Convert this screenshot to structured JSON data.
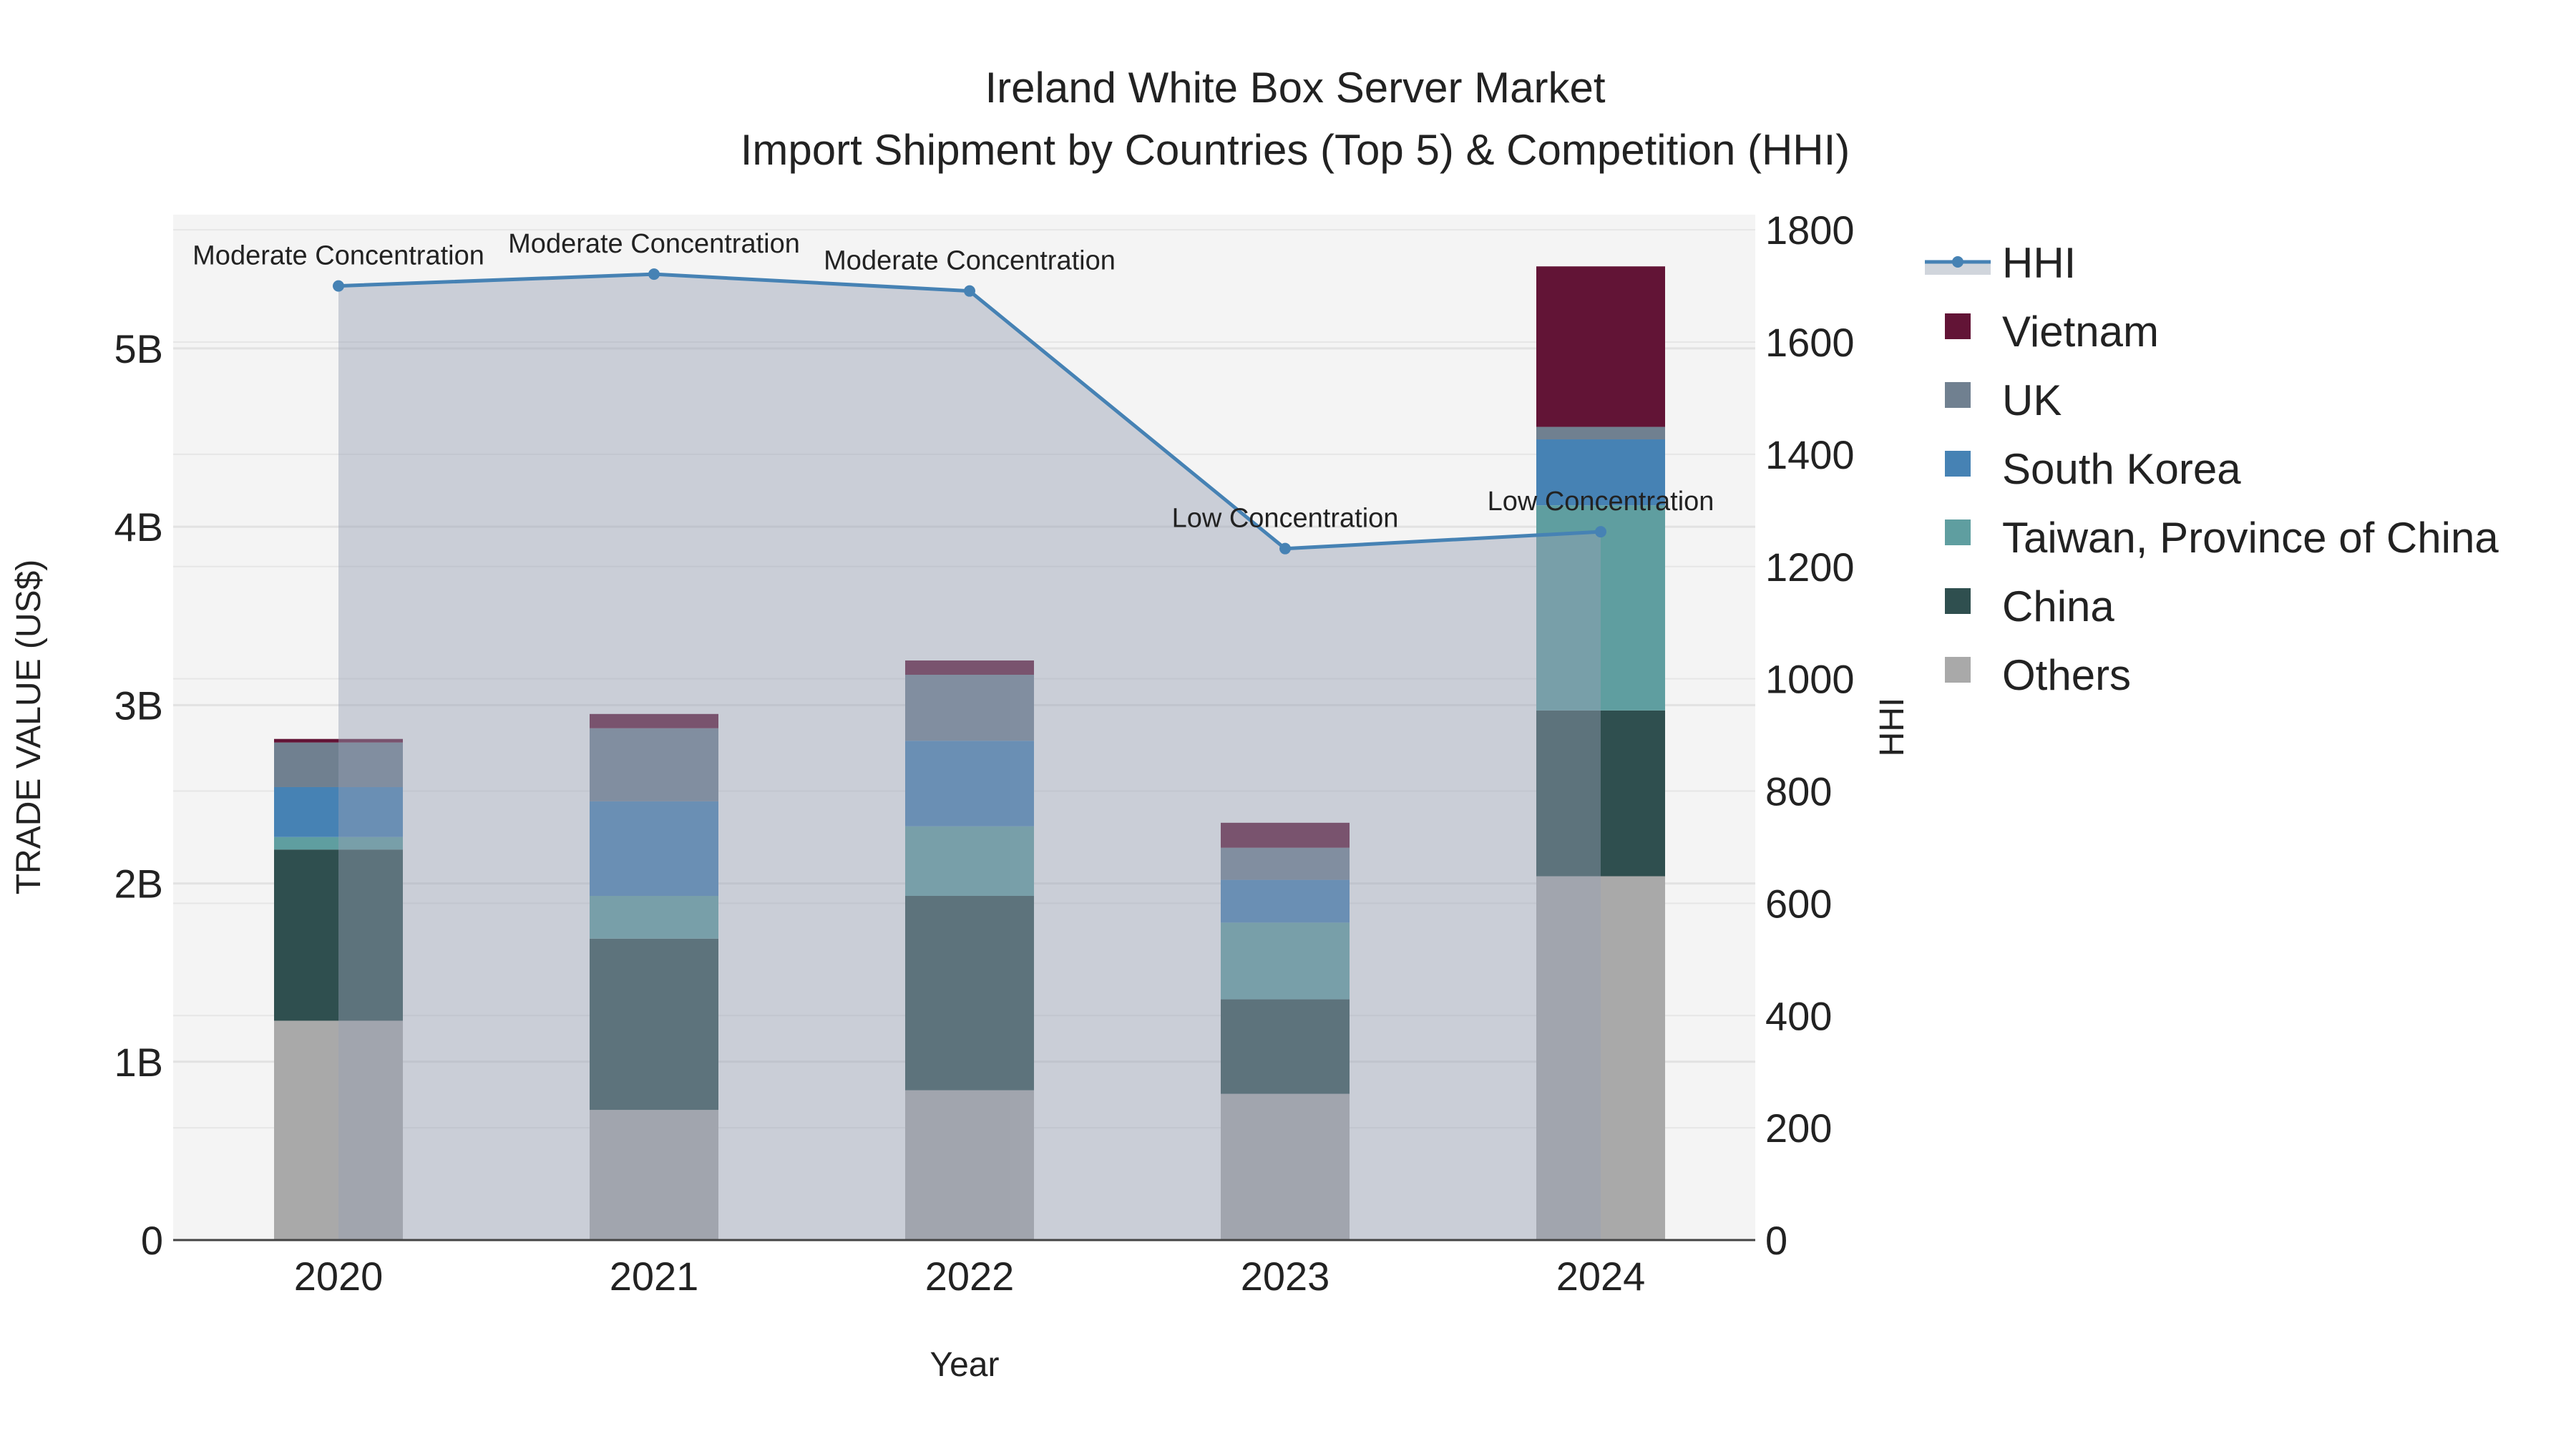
{
  "chart_data": {
    "type": "bar",
    "title": "Ireland White Box Server Market",
    "subtitle": "Import Shipment by Countries (Top 5) & Competition (HHI)",
    "xlabel": "Year",
    "ylabel": "TRADE VALUE (US$)",
    "y2label": "HHI",
    "categories": [
      "2020",
      "2021",
      "2022",
      "2023",
      "2024"
    ],
    "ylim": [
      0,
      5.75
    ],
    "y_ticks": [
      0,
      1,
      2,
      3,
      4,
      5
    ],
    "y_tick_labels": [
      "0",
      "1B",
      "2B",
      "3B",
      "4B",
      "5B"
    ],
    "y2lim": [
      0,
      1827
    ],
    "y2_ticks": [
      0,
      200,
      400,
      600,
      800,
      1000,
      1200,
      1400,
      1600,
      1800
    ],
    "y2_tick_labels": [
      "0",
      "200",
      "400",
      "600",
      "800",
      "1000",
      "1200",
      "1400",
      "1600",
      "1800"
    ],
    "units": "billion US$",
    "stacked": true,
    "legend_position": "right",
    "series": [
      {
        "name": "Others",
        "color": "#a9a9a9",
        "values": [
          1.23,
          0.73,
          0.84,
          0.82,
          2.04
        ]
      },
      {
        "name": "China",
        "color": "#2f4f4f",
        "values": [
          0.96,
          0.96,
          1.09,
          0.53,
          0.93
        ]
      },
      {
        "name": "Taiwan, Province of China",
        "color": "#5f9ea0",
        "values": [
          0.07,
          0.24,
          0.39,
          0.43,
          1.15
        ]
      },
      {
        "name": "South Korea",
        "color": "#4682b4",
        "values": [
          0.28,
          0.53,
          0.48,
          0.24,
          0.37
        ]
      },
      {
        "name": "UK",
        "color": "#708090",
        "values": [
          0.25,
          0.41,
          0.37,
          0.18,
          0.07
        ]
      },
      {
        "name": "Vietnam",
        "color": "#621436",
        "values": [
          0.02,
          0.08,
          0.08,
          0.14,
          0.9
        ]
      }
    ],
    "hhi": {
      "name": "HHI",
      "color": "#4682b4",
      "values": [
        1700,
        1721,
        1691,
        1232,
        1262
      ],
      "annotations": [
        "Moderate Concentration",
        "Moderate Concentration",
        "Moderate Concentration",
        "Low Concentration",
        "Low Concentration"
      ]
    },
    "legend_order": [
      "HHI",
      "Vietnam",
      "UK",
      "South Korea",
      "Taiwan, Province of China",
      "China",
      "Others"
    ]
  }
}
